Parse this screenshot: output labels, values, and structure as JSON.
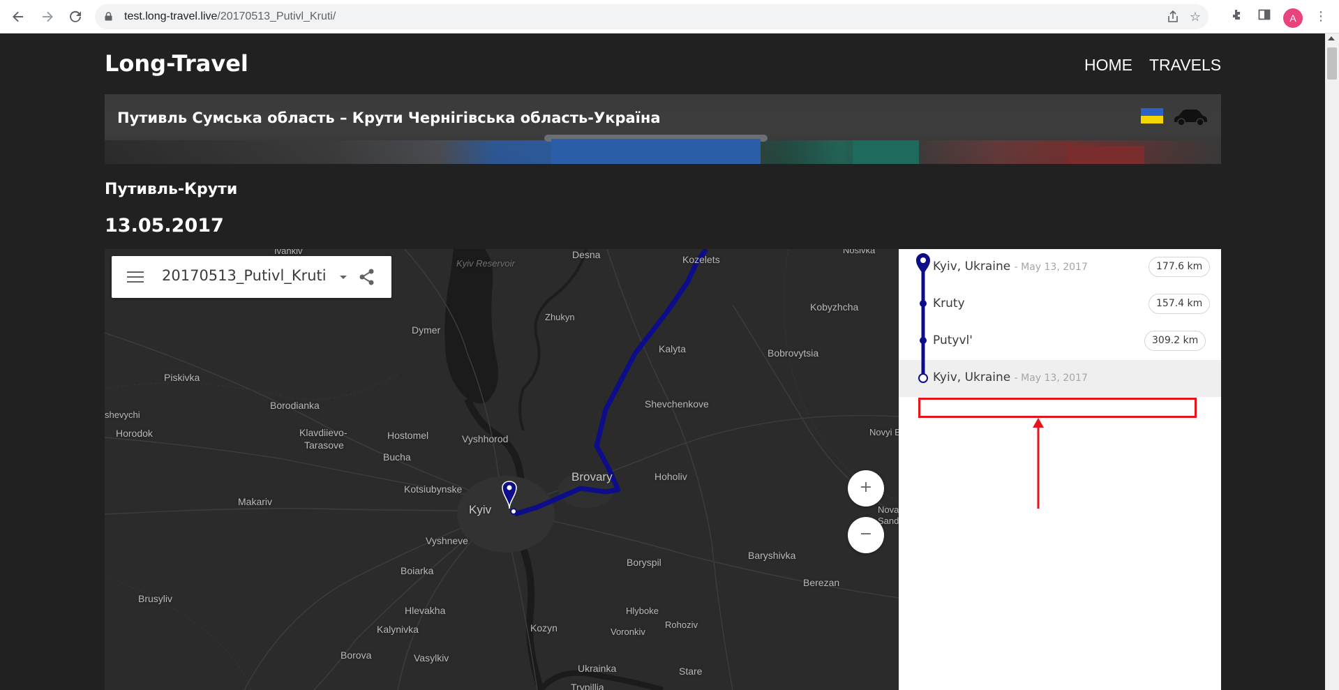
{
  "browser": {
    "url_host": "test.long-travel.live",
    "url_path": "/20170513_Putivl_Kruti/",
    "avatar_letter": "A",
    "icons": [
      "back-icon",
      "forward-icon",
      "reload-icon",
      "lock-icon",
      "share-page-icon",
      "bookmark-star-icon",
      "extensions-icon",
      "sidebar-icon",
      "kebab-menu-icon"
    ]
  },
  "site": {
    "title": "Long-Travel",
    "nav": [
      {
        "label": "HOME"
      },
      {
        "label": "TRAVELS"
      }
    ]
  },
  "banner": {
    "title": "Путивль Сумська область – Крути Чернігівська область-Україна",
    "flag_colors": [
      "#2a62c9",
      "#f5d500"
    ],
    "icons": [
      "ukraine-flag-icon",
      "car-icon"
    ]
  },
  "trip": {
    "subtitle": "Путивль-Крути",
    "date": "13.05.2017"
  },
  "map": {
    "card_name": "20170513_Putivl_Kruti",
    "route_color": "#0d0d8a",
    "zoom_in": "+",
    "zoom_out": "−",
    "places": {
      "ivankiv": "Ivankiv",
      "desna": "Desna",
      "kyiv_reservoir": "Kyiv Reservoir",
      "kozelets": "Kozelets",
      "nosivka": "Nosivka",
      "zhukyn": "Zhukyn",
      "kobyzhcha": "Kobyzhcha",
      "dymer": "Dymer",
      "kalyta": "Kalyta",
      "bobrovytsia": "Bobrovytsia",
      "piskivka": "Piskivka",
      "borodianka": "Borodianka",
      "shevchenkove": "Shevchenkove",
      "shevychi": "shevychi",
      "horodok": "Horodok",
      "klavdiievo": "Klavdiievo-",
      "tarasove": "Tarasove",
      "hostomel": "Hostomel",
      "vyshhorod": "Vyshhorod",
      "novyi_b": "Novyi B",
      "bucha": "Bucha",
      "brovary": "Brovary",
      "hoholiv": "Hoholiv",
      "kotsiubynske": "Kotsiubynske",
      "makariv": "Makariv",
      "kyiv": "Kyiv",
      "nova_sand": "Nova",
      "sand": "Sand",
      "vyshneve": "Vyshneve",
      "boryspil": "Boryspil",
      "baryshivka": "Baryshivka",
      "boiarka": "Boiarka",
      "berezan": "Berezan",
      "brusyliv": "Brusyliv",
      "hlevakha": "Hlevakha",
      "hlyboke": "Hlyboke",
      "rohoziv": "Rohoziv",
      "kalynivka": "Kalynivka",
      "kozyn": "Kozyn",
      "voronkiv": "Voronkiv",
      "borova": "Borova",
      "vasylkiv": "Vasylkiv",
      "ukrainka": "Ukrainka",
      "stare": "Stare",
      "trypillia": "Trypillia"
    }
  },
  "itinerary": {
    "stops": [
      {
        "name": "Kyiv, Ukraine",
        "date": "- May 13, 2017",
        "distance": "177.6 km"
      },
      {
        "name": "Kruty",
        "date": "",
        "distance": "157.4 km"
      },
      {
        "name": "Putyvl'",
        "date": "",
        "distance": "309.2 km"
      },
      {
        "name": "Kyiv, Ukraine",
        "date": "- May 13, 2017",
        "distance": ""
      }
    ],
    "timeline_color": "#0d0d8a"
  },
  "annotation": {
    "color": "#e8141b"
  }
}
